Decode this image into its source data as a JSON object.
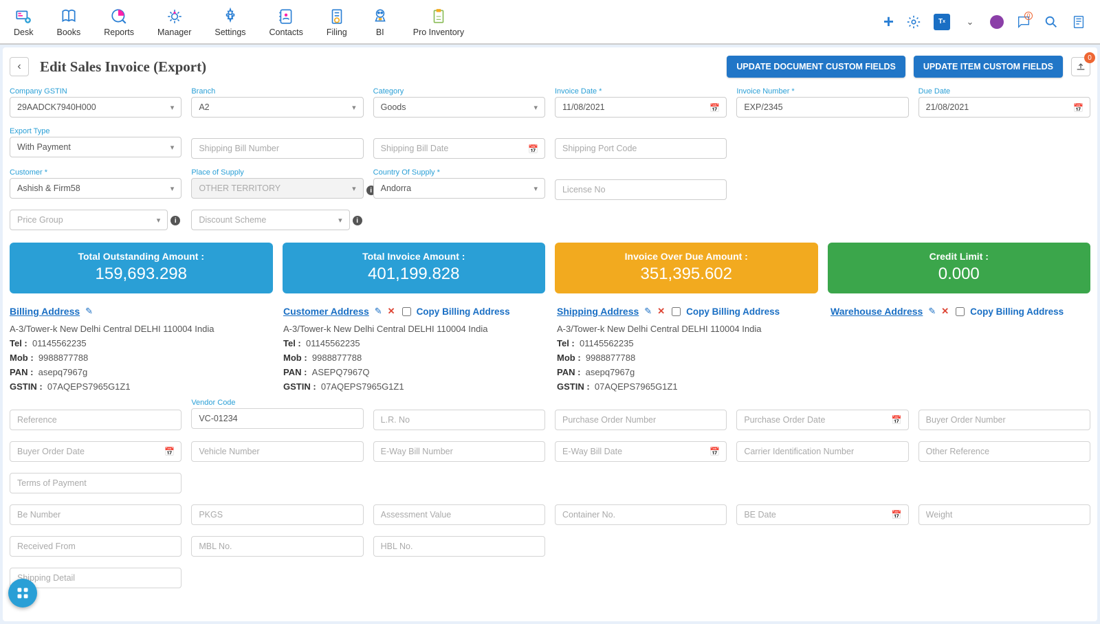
{
  "nav": {
    "items": [
      {
        "label": "Desk"
      },
      {
        "label": "Books"
      },
      {
        "label": "Reports"
      },
      {
        "label": "Manager"
      },
      {
        "label": "Settings"
      },
      {
        "label": "Contacts"
      },
      {
        "label": "Filing"
      },
      {
        "label": "BI"
      },
      {
        "label": "Pro Inventory"
      }
    ],
    "notif_count": "0",
    "upload_count": "0"
  },
  "page": {
    "title": "Edit Sales Invoice (Export)",
    "btn_doc_cf": "UPDATE DOCUMENT CUSTOM FIELDS",
    "btn_item_cf": "UPDATE ITEM CUSTOM FIELDS"
  },
  "fields": {
    "company_gstin": {
      "label": "Company GSTIN",
      "value": "29AADCK7940H000"
    },
    "branch": {
      "label": "Branch",
      "value": "A2"
    },
    "category": {
      "label": "Category",
      "value": "Goods"
    },
    "invoice_date": {
      "label": "Invoice Date *",
      "value": "11/08/2021"
    },
    "invoice_no": {
      "label": "Invoice Number *",
      "value": "EXP/2345"
    },
    "due_date": {
      "label": "Due Date",
      "value": "21/08/2021"
    },
    "export_type": {
      "label": "Export Type",
      "value": "With Payment"
    },
    "ship_bill_no": {
      "placeholder": "Shipping Bill Number"
    },
    "ship_bill_date": {
      "placeholder": "Shipping Bill Date"
    },
    "ship_port": {
      "placeholder": "Shipping Port Code"
    },
    "customer": {
      "label": "Customer *",
      "value": "Ashish & Firm58"
    },
    "pos": {
      "label": "Place of Supply",
      "value": "OTHER TERRITORY"
    },
    "cos": {
      "label": "Country Of Supply *",
      "value": "Andorra"
    },
    "license": {
      "placeholder": "License No"
    },
    "price_group": {
      "placeholder": "Price Group"
    },
    "discount_scheme": {
      "placeholder": "Discount Scheme"
    }
  },
  "stats": {
    "outstanding": {
      "label": "Total Outstanding Amount :",
      "value": "159,693.298"
    },
    "invoice_amt": {
      "label": "Total Invoice Amount :",
      "value": "401,199.828"
    },
    "overdue": {
      "label": "Invoice Over Due Amount :",
      "value": "351,395.602"
    },
    "credit": {
      "label": "Credit Limit :",
      "value": "0.000"
    }
  },
  "addr_common": {
    "copy": "Copy Billing Address"
  },
  "billing": {
    "title": "Billing Address",
    "addr": "A-3/Tower-k New Delhi Central DELHI 110004 India",
    "tel": "01145562235",
    "mob": "9988877788",
    "pan": "asepq7967g",
    "gstin": "07AQEPS7965G1Z1"
  },
  "customer_addr": {
    "title": "Customer Address",
    "addr": "A-3/Tower-k New Delhi Central DELHI 110004 India",
    "tel": "01145562235",
    "mob": "9988877788",
    "pan": "ASEPQ7967Q",
    "gstin": "07AQEPS7965G1Z1"
  },
  "shipping": {
    "title": "Shipping Address",
    "addr": "A-3/Tower-k New Delhi Central DELHI 110004 India",
    "tel": "01145562235",
    "mob": "9988877788",
    "pan": "asepq7967g",
    "gstin": "07AQEPS7965G1Z1"
  },
  "warehouse": {
    "title": "Warehouse Address"
  },
  "lower": {
    "reference": {
      "placeholder": "Reference"
    },
    "vendor_code": {
      "label": "Vendor Code",
      "value": "VC-01234"
    },
    "lr_no": {
      "placeholder": "L.R. No"
    },
    "po_no": {
      "placeholder": "Purchase Order Number"
    },
    "po_date": {
      "placeholder": "Purchase Order Date"
    },
    "buyer_order_no": {
      "placeholder": "Buyer Order Number"
    },
    "buyer_order_date": {
      "placeholder": "Buyer Order Date"
    },
    "vehicle_no": {
      "placeholder": "Vehicle Number"
    },
    "eway_no": {
      "placeholder": "E-Way Bill Number"
    },
    "eway_date": {
      "placeholder": "E-Way Bill Date"
    },
    "carrier_id": {
      "placeholder": "Carrier Identification Number"
    },
    "other_ref": {
      "placeholder": "Other Reference"
    },
    "terms": {
      "placeholder": "Terms of Payment"
    },
    "be_no": {
      "placeholder": "Be Number"
    },
    "pkgs": {
      "placeholder": "PKGS"
    },
    "assess": {
      "placeholder": "Assessment Value"
    },
    "container": {
      "placeholder": "Container No."
    },
    "be_date": {
      "placeholder": "BE Date"
    },
    "weight": {
      "placeholder": "Weight"
    },
    "received": {
      "placeholder": "Received From"
    },
    "mbl": {
      "placeholder": "MBL No."
    },
    "hbl": {
      "placeholder": "HBL No."
    },
    "ship_detail": {
      "placeholder": "Shipping Detail"
    }
  }
}
